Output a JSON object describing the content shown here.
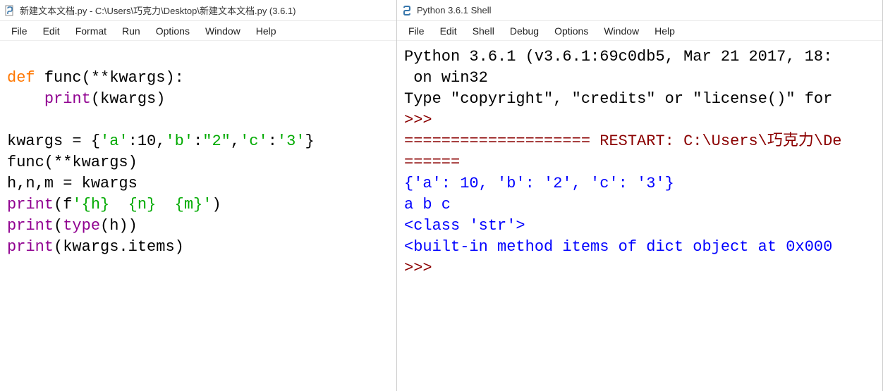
{
  "left": {
    "title": "新建文本文档.py - C:\\Users\\巧克力\\Desktop\\新建文本文档.py (3.6.1)",
    "menus": [
      "File",
      "Edit",
      "Format",
      "Run",
      "Options",
      "Window",
      "Help"
    ],
    "code": {
      "l1_def": "def",
      "l1_rest": " func(**kwargs):",
      "l2_indent": "    ",
      "l2_print": "print",
      "l2_rest": "(kwargs)",
      "l3": "",
      "l4a": "kwargs = {",
      "l4s1": "'a'",
      "l4b": ":10,",
      "l4s2": "'b'",
      "l4c": ":",
      "l4s3": "\"2\"",
      "l4d": ",",
      "l4s4": "'c'",
      "l4e": ":",
      "l4s5": "'3'",
      "l4f": "}",
      "l5": "func(**kwargs)",
      "l6": "h,n,m = kwargs",
      "l7_print": "print",
      "l7_rest1": "(f",
      "l7_str": "'{h}  {n}  {m}'",
      "l7_rest2": ")",
      "l8_print": "print",
      "l8_rest1": "(",
      "l8_type": "type",
      "l8_rest2": "(h))",
      "l9_print": "print",
      "l9_rest": "(kwargs.items)"
    }
  },
  "right": {
    "title": "Python 3.6.1 Shell",
    "menus": [
      "File",
      "Edit",
      "Shell",
      "Debug",
      "Options",
      "Window",
      "Help"
    ],
    "shell": {
      "s1": "Python 3.6.1 (v3.6.1:69c0db5, Mar 21 2017, 18:",
      "s2": " on win32",
      "s3a": "Type ",
      "s3b": "\"copyright\"",
      "s3c": ", ",
      "s3d": "\"credits\"",
      "s3e": " or ",
      "s3f": "\"license()\"",
      "s3g": " for",
      "prompt1": ">>>",
      "s4": "==================== RESTART: C:\\Users\\巧克力\\De",
      "s5": "======",
      "s6": "{'a': 10, 'b': '2', 'c': '3'}",
      "s7": "a b c",
      "s8": "<class 'str'>",
      "s9": "<built-in method items of dict object at 0x000",
      "prompt2": ">>>"
    }
  }
}
